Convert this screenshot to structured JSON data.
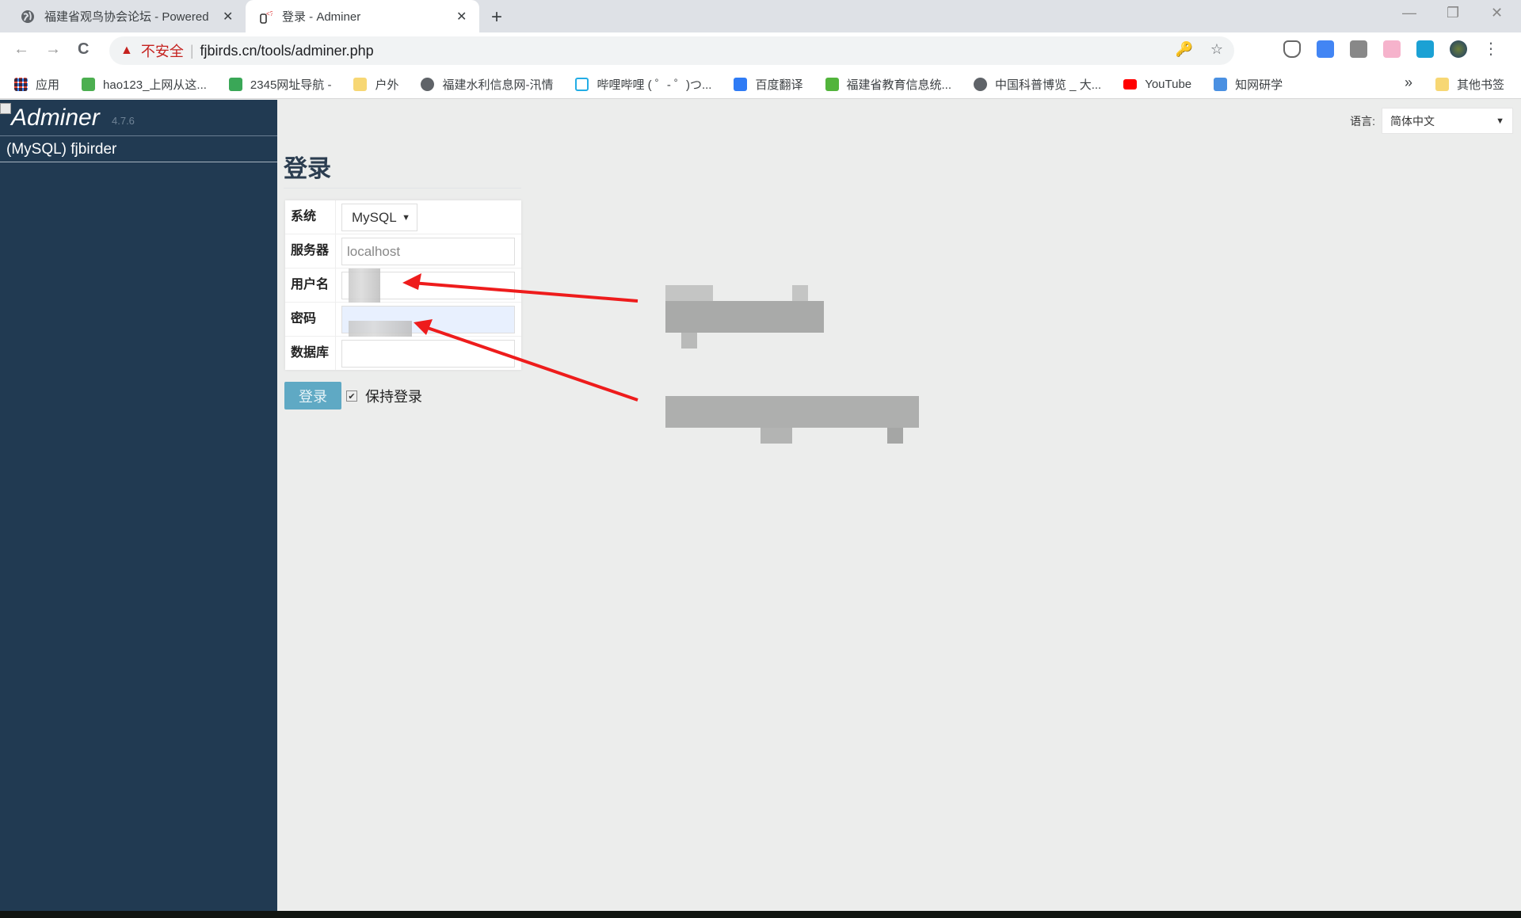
{
  "browser": {
    "tabs": [
      {
        "title": "福建省观鸟协会论坛 - Powered",
        "icon": "globe-icon",
        "active": false
      },
      {
        "title": "登录 - Adminer",
        "icon": "adminer-icon",
        "active": true
      }
    ],
    "new_tab": "+",
    "window_controls": {
      "minimize": "—",
      "restore": "❐",
      "close": "✕"
    },
    "nav": {
      "back": "←",
      "forward": "→",
      "reload": "C"
    },
    "address": {
      "security_label": "不安全",
      "url": "fjbirds.cn/tools/adminer.php"
    },
    "omnibox_icons": {
      "key": "🔑",
      "star": "☆"
    },
    "menu": "⋮",
    "bookmarks": [
      {
        "label": "应用",
        "icon": "apps-grid-icon",
        "color": "#e84b3c"
      },
      {
        "label": "hao123_上网从这...",
        "icon": "hao123-icon",
        "color": "#4caf50"
      },
      {
        "label": "2345网址导航 -",
        "icon": "2345-icon",
        "color": "#3aa757"
      },
      {
        "label": "户外",
        "icon": "folder-icon",
        "color": "#f7d774"
      },
      {
        "label": "福建水利信息网-汛情",
        "icon": "globe-icon",
        "color": "#5f6368"
      },
      {
        "label": "哔哩哔哩 ( ゜- ゜)つ...",
        "icon": "bilibili-icon",
        "color": "#23ade5"
      },
      {
        "label": "百度翻译",
        "icon": "baidu-translate-icon",
        "color": "#2f7bf5"
      },
      {
        "label": "福建省教育信息统...",
        "icon": "edu-icon",
        "color": "#52b43c"
      },
      {
        "label": "中国科普博览 _ 大...",
        "icon": "globe-icon",
        "color": "#5f6368"
      },
      {
        "label": "YouTube",
        "icon": "youtube-icon",
        "color": "#ff0000"
      },
      {
        "label": "知网研学",
        "icon": "cnki-icon",
        "color": "#4a90e2"
      }
    ],
    "bookmarks_more": "»",
    "other_bookmarks": "其他书签"
  },
  "sidebar": {
    "logo": "Adminer",
    "version": "4.7.6",
    "connection": "(MySQL) fjbirder"
  },
  "language": {
    "label": "语言:",
    "selected": "简体中文"
  },
  "main": {
    "title": "登录",
    "form": {
      "system": {
        "label": "系统",
        "value": "MySQL"
      },
      "server": {
        "label": "服务器",
        "placeholder": "localhost",
        "value": ""
      },
      "username": {
        "label": "用户名",
        "value": "[redacted]"
      },
      "password": {
        "label": "密码",
        "value": "[redacted]"
      },
      "database": {
        "label": "数据库",
        "value": ""
      }
    },
    "login_button": "登录",
    "remember": {
      "label": "保持登录",
      "checked": true
    }
  },
  "annotations": {
    "arrow_color": "#ee1c1c",
    "notes": [
      "[redacted username note]",
      "[redacted password note]"
    ]
  }
}
